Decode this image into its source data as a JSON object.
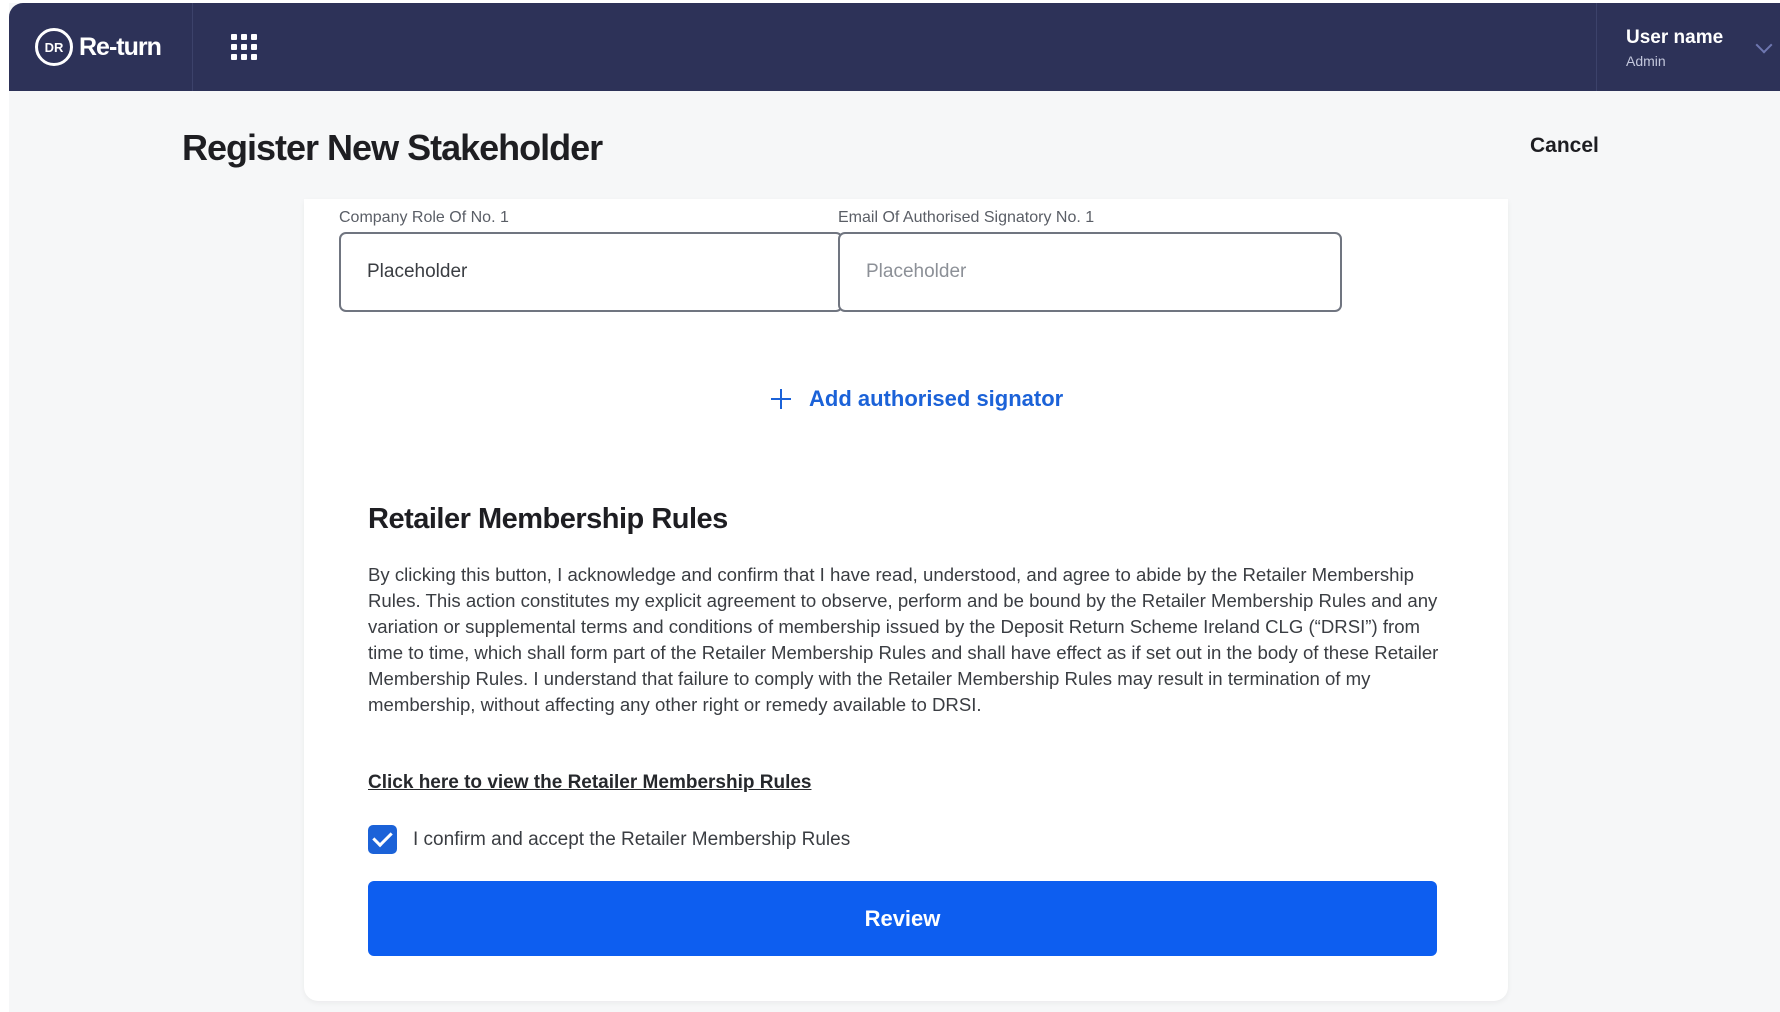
{
  "app": {
    "logo_mark": "DR",
    "logo_text": "Re-turn"
  },
  "user": {
    "name": "User name",
    "role": "Admin"
  },
  "header": {
    "title": "Register New Stakeholder",
    "cancel_label": "Cancel"
  },
  "form": {
    "company_role": {
      "label": "Company Role Of No. 1",
      "value": "",
      "placeholder": "Placeholder"
    },
    "email": {
      "label": "Email Of Authorised Signatory No. 1",
      "value": "",
      "placeholder": "Placeholder"
    },
    "add_signator_label": "Add authorised signator"
  },
  "rules": {
    "title": "Retailer Membership Rules",
    "body": "By clicking this button, I acknowledge and confirm that I have read, understood, and agree to abide by the Retailer Membership Rules. This action constitutes my explicit agreement to observe, perform and be bound by the Retailer Membership Rules and any variation or supplemental terms and conditions of membership issued by the Deposit Return Scheme Ireland CLG (“DRSI”) from time to time, which shall form part of the Retailer Membership Rules and shall have effect as if set out in the body of these Retailer Membership Rules. I understand that failure to comply with the Retailer Membership Rules may result in termination of my membership, without affecting any other right or remedy available to DRSI.",
    "link_label": "Click here to view the Retailer Membership Rules",
    "confirm_label": "I confirm and accept the Retailer Membership Rules",
    "confirm_checked": true
  },
  "actions": {
    "review_label": "Review"
  },
  "colors": {
    "topbar": "#2d3258",
    "accent": "#0d5ef0",
    "link": "#1b62d8"
  },
  "icons": {
    "logo": "logo-icon",
    "apps": "apps-grid-icon",
    "user_menu": "chevron-down-icon",
    "add": "plus-icon",
    "check": "checkmark-icon"
  }
}
